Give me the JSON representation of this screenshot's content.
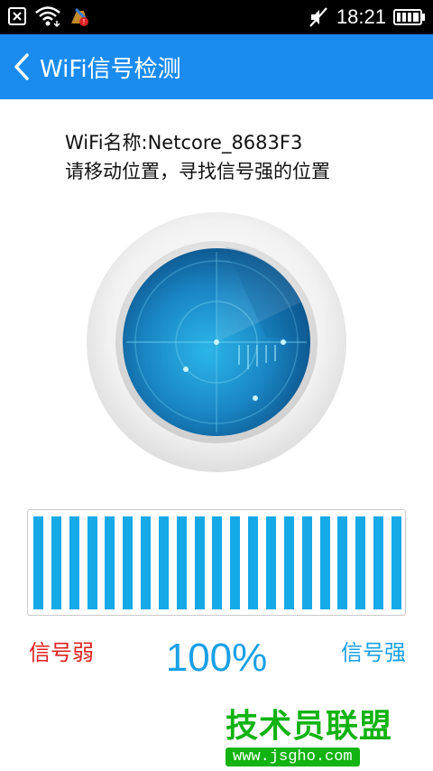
{
  "status_bar": {
    "time": "18:21",
    "icons": [
      "close-box-icon",
      "wifi-icon",
      "app-notification-icon",
      "mute-icon",
      "battery-icon"
    ]
  },
  "header": {
    "title": "WiFi信号检测",
    "back_icon": "chevron-left-icon",
    "background": "#1a8cf0"
  },
  "info": {
    "wifi_name_line": "WiFi名称:Netcore_8683F3",
    "instruction": "请移动位置，寻找信号强的位置"
  },
  "meter": {
    "level": 1.0,
    "bar_count": 21,
    "bar_color": "#16a9e8",
    "weak_label": "信号弱",
    "strong_label": "信号强",
    "percent_text": "100%"
  },
  "watermark": {
    "title": "技术员联盟",
    "url": "www.jsgho.com",
    "color": "#12b312"
  }
}
